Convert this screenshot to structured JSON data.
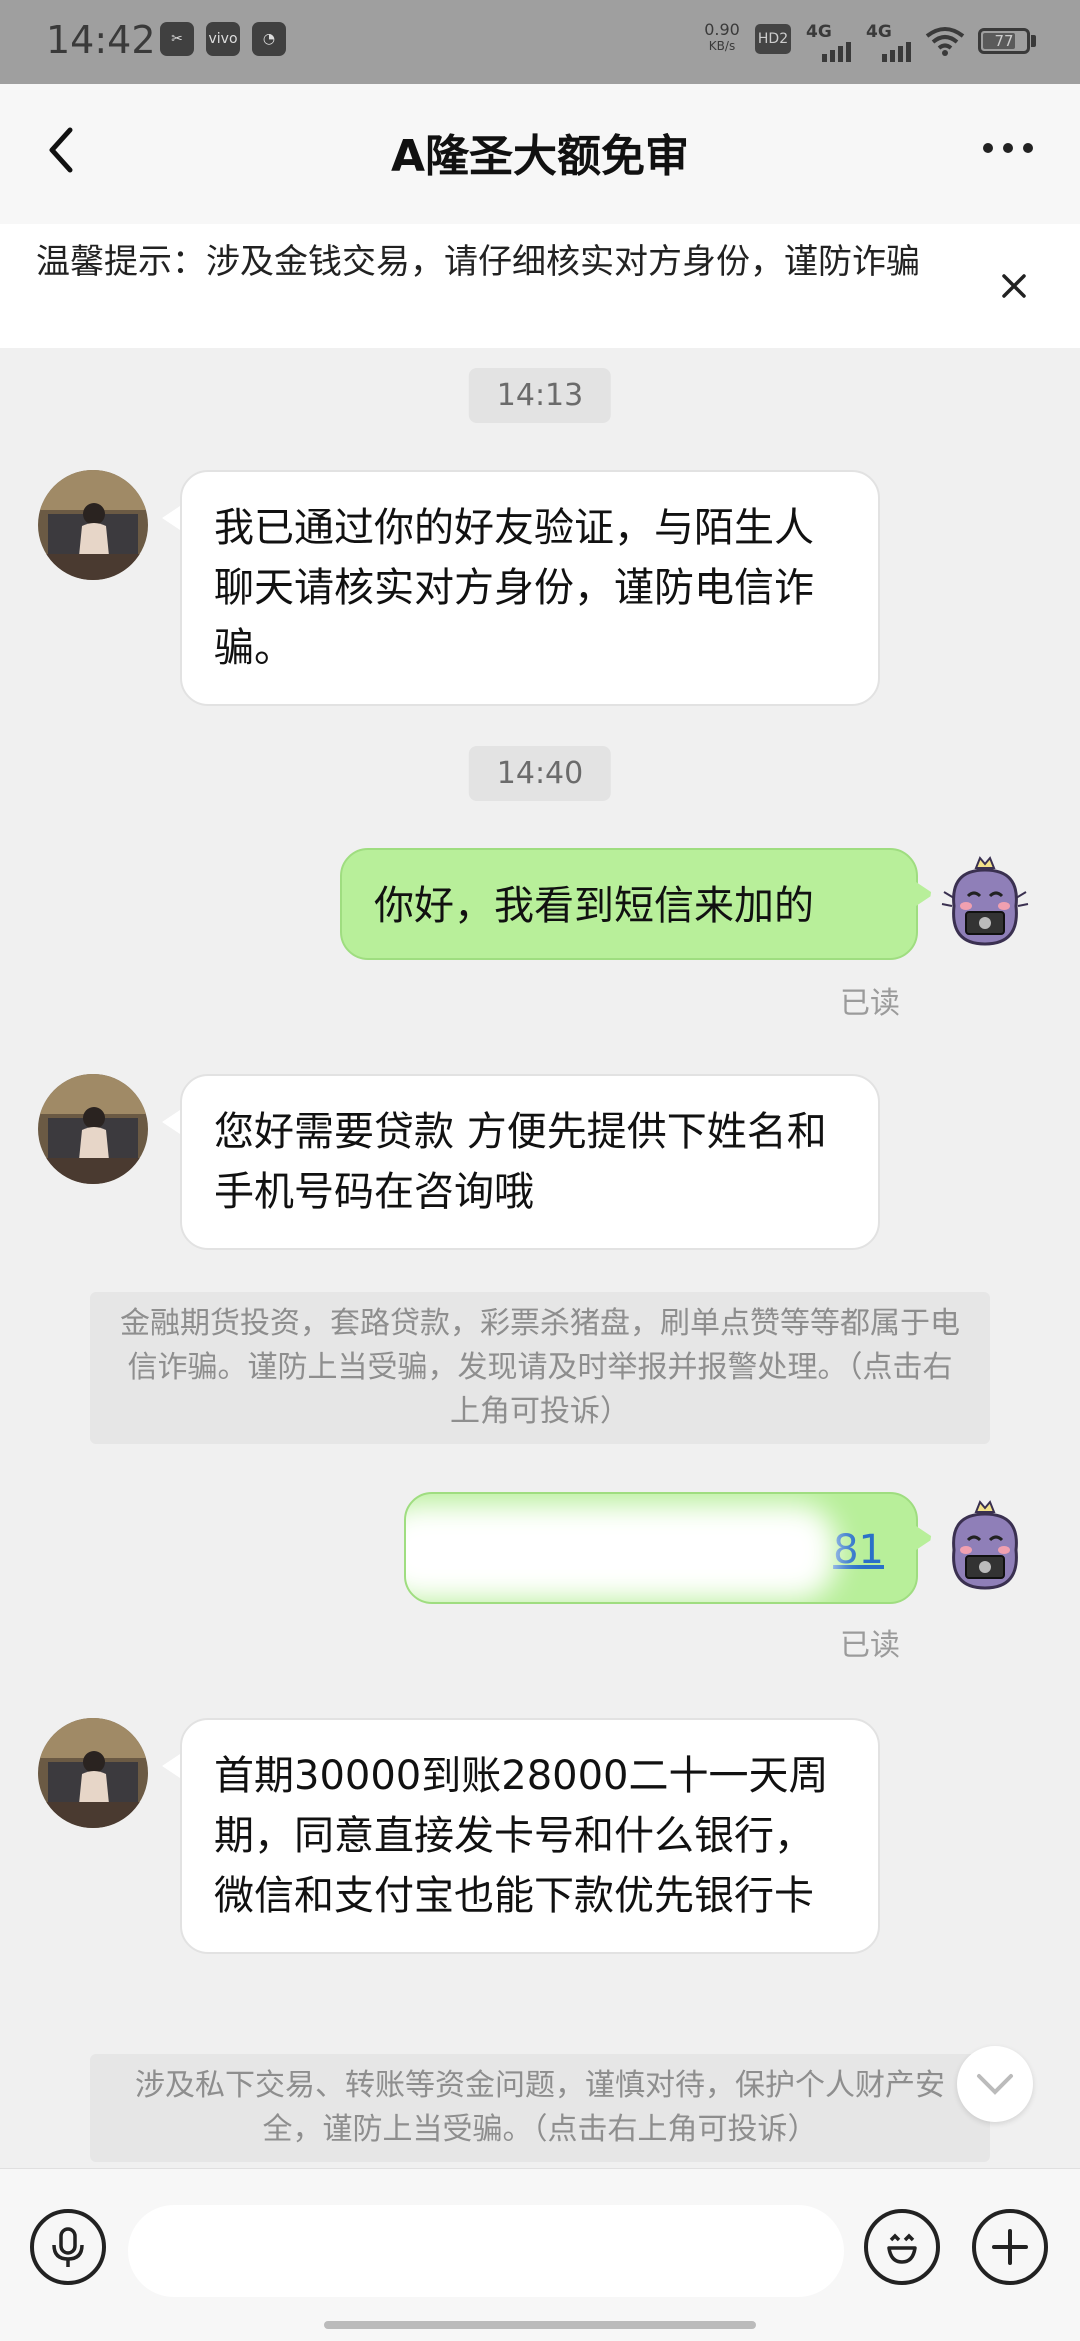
{
  "status_bar": {
    "time": "14:42",
    "left_icons": [
      "scissors-icon",
      "vivo-icon",
      "app-icon"
    ],
    "net_speed_value": "0.90",
    "net_speed_unit": "KB/s",
    "hd": "HD2",
    "sim1": "4G",
    "sim2": "4G",
    "battery": "77",
    "battery_level": 0.77
  },
  "header": {
    "title": "A隆圣大额免审"
  },
  "warning": {
    "text": "温馨提示：涉及金钱交易，请仔细核实对方身份，谨防诈骗"
  },
  "messages": {
    "t1": "14:13",
    "m1": "我已通过你的好友验证，与陌生人聊天请核实对方身份，谨防电信诈骗。",
    "t2": "14:40",
    "m2": "你好，我看到短信来加的",
    "read1": "已读",
    "m3": "您好需要贷款 方便先提供下姓名和手机号码在咨询哦",
    "notice1": "金融期货投资，套路贷款，彩票杀猪盘，刷单点赞等等都属于电信诈骗。谨防上当受骗，发现请及时举报并报警处理。（点击右上角可投诉）",
    "m4_visible": "81",
    "read2": "已读",
    "m5": "首期30000到账28000二十一天周期，同意直接发卡号和什么银行，微信和支付宝也能下款优先银行卡",
    "notice2": "涉及私下交易、转账等资金问题，谨慎对待，保护个人财产安全，谨防上当受骗。（点击右上角可投诉）"
  },
  "input": {
    "placeholder": ""
  },
  "colors": {
    "accent_bubble": "#b8ef9a",
    "status_bar": "#9f9f9f",
    "background": "#f0f0f0"
  }
}
